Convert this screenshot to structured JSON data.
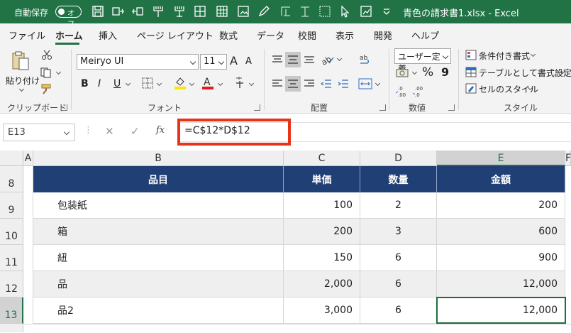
{
  "titlebar": {
    "autosave_label": "自動保存",
    "autosave_state": "オフ",
    "doc_title": "青色の請求書1.xlsx  -  Excel",
    "qat_icons": [
      "save-icon",
      "sort-icon",
      "filter-icon",
      "clear-filter-icon",
      "brush-icon",
      "table-icon",
      "grid-icon",
      "picture-icon",
      "pencil-icon",
      "format-icon",
      "pointer-icon",
      "chart-icon",
      "customize-icon"
    ]
  },
  "ribbon_tabs": [
    "ファイル",
    "ホーム",
    "挿入",
    "ページ レイアウト",
    "数式",
    "データ",
    "校閲",
    "表示",
    "開発",
    "ヘルプ"
  ],
  "ribbon": {
    "paste_label": "貼り付け",
    "clipboard_label": "クリップボード",
    "font_name": "Meiryo UI",
    "font_size": "11",
    "font_label": "フォント",
    "bold": "B",
    "italic": "I",
    "underline": "U",
    "grow_font": "A",
    "shrink_font": "A",
    "alignment_label": "配置",
    "number_format": "ユーザー定義",
    "percent": "%",
    "comma": "9",
    "number_label": "数値",
    "conditional_format": "条件付き書式",
    "format_as_table": "テーブルとして書式設定",
    "cell_styles": "セルのスタイル",
    "styles_label": "スタイル"
  },
  "formula_bar": {
    "name_box": "E13",
    "cancel": "✕",
    "enter": "✓",
    "fx": "fx",
    "formula": "=C$12*D$12"
  },
  "sheet": {
    "columns": [
      "A",
      "B",
      "C",
      "D",
      "E",
      "F"
    ],
    "rows": [
      "8",
      "9",
      "10",
      "11",
      "12",
      "13"
    ],
    "header": [
      "品目",
      "単価",
      "数量",
      "金額"
    ],
    "data": [
      [
        "包装紙",
        "100",
        "2",
        "200"
      ],
      [
        "箱",
        "200",
        "3",
        "600"
      ],
      [
        "紐",
        "150",
        "6",
        "900"
      ],
      [
        "品",
        "2,000",
        "6",
        "12,000"
      ],
      [
        "品2",
        "3,000",
        "6",
        "12,000"
      ]
    ]
  },
  "colors": {
    "title_bar": "#217346",
    "table_header": "#1f3f75",
    "highlight_box": "#e8321a",
    "selection": "#217346"
  }
}
